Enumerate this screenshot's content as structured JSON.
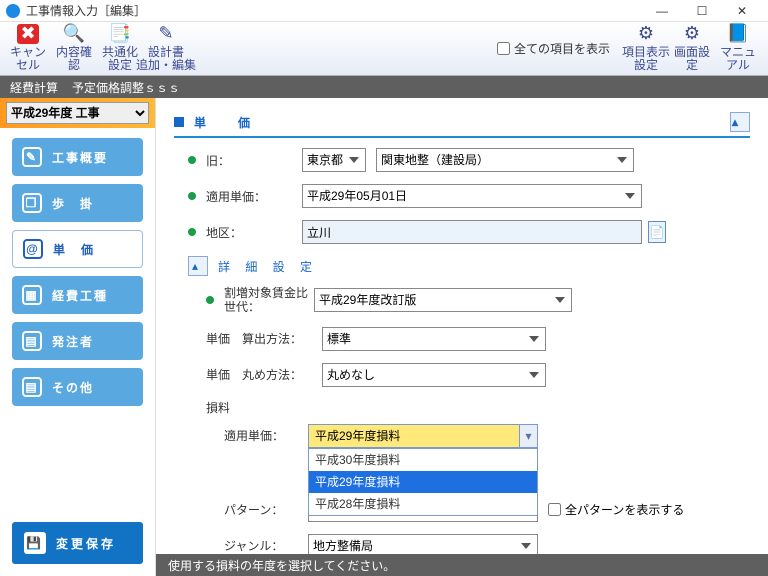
{
  "window": {
    "title": "工事情報入力［編集］",
    "min": "—",
    "max": "☐",
    "close": "✕"
  },
  "toolbar": {
    "cancel": "キャンセル",
    "confirm": "内容確認",
    "common": "共通化\n設定",
    "design": "設計書\n追加・編集",
    "show_all": "全ての項目を表示",
    "disp": "項目表示\n設定",
    "screen": "画面設定",
    "manual": "マニュアル"
  },
  "breadcrumb": {
    "a": "経費計算",
    "b": "予定価格調整ｓｓｓ"
  },
  "year_select": "平成29年度 工事",
  "nav": {
    "overview": "工事概要",
    "step": "歩　掛",
    "unit": "単　価",
    "cost": "経費工種",
    "client": "発注者",
    "other": "その他"
  },
  "save": "変更保存",
  "section": {
    "title": "単　価",
    "collapse": "▴"
  },
  "fields": {
    "old": "旧：",
    "old_v": "東京都",
    "old_v2": "関東地整（建設局）",
    "apply": "適用単価：",
    "apply_v": "平成29年05月01日",
    "area": "地区：",
    "area_v": "立川",
    "detail": "詳 細 設 定",
    "ratio": "割増対象賃金比世代：",
    "ratio_v": "平成29年度改訂版",
    "calc": "単価　算出方法：",
    "calc_v": "標準",
    "round": "単価　丸め方法：",
    "round_v": "丸めなし",
    "group": "損料",
    "apply2": "適用単価：",
    "apply2_v": "平成29年度損料",
    "opt1": "平成30年度損料",
    "opt2": "平成29年度損料",
    "opt3": "平成28年度損料",
    "pattern": "パターン：",
    "pattern_chk": "全パターンを表示する",
    "genre": "ジャンル：",
    "genre_v": "地方整備局"
  },
  "status": "使用する損料の年度を選択してください。"
}
